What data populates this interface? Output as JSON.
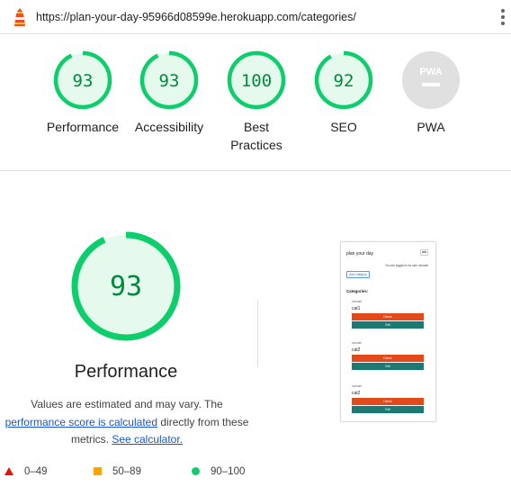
{
  "topbar": {
    "url": "https://plan-your-day-95966d08599e.herokuapp.com/categories/",
    "logo_icon": "lighthouse-icon",
    "menu_icon": "kebab-menu-icon"
  },
  "colors": {
    "pass": "#0cce6b",
    "pass_fill": "#e5f9ed",
    "pass_text": "#008a3e",
    "average": "#ffa400",
    "fail": "#eb0f00",
    "na": "#e0e0e0",
    "link": "#1a56c0",
    "delete_button": "#e2491b",
    "edit_button": "#1d7a72"
  },
  "gauges": [
    {
      "score": 93,
      "label": "Performance"
    },
    {
      "score": 93,
      "label": "Accessibility"
    },
    {
      "score": 100,
      "label": "Best Practices",
      "label_line1": "Best",
      "label_line2": "Practices"
    },
    {
      "score": 92,
      "label": "SEO"
    },
    {
      "score": null,
      "label": "PWA",
      "badge": "PWA"
    }
  ],
  "detail": {
    "score": 93,
    "title": "Performance",
    "desc_prefix": "Values are estimated and may vary. The",
    "desc_link": "performance score is calculated",
    "desc_middle": "directly from these metrics.",
    "calculator_link": "See calculator."
  },
  "legend": [
    {
      "range": "0–49",
      "shape": "triangle"
    },
    {
      "range": "50–89",
      "shape": "square"
    },
    {
      "range": "90–100",
      "shape": "circle"
    }
  ],
  "thumbnail": {
    "brand": "plan your day",
    "notice": "You are logged in as user michael",
    "add_button": "Add Category",
    "heading": "Categories:",
    "cards": [
      {
        "user": "michael",
        "name": "cat1",
        "delete": "Delete",
        "edit": "Edit"
      },
      {
        "user": "michael",
        "name": "cat2",
        "delete": "Delete",
        "edit": "Edit"
      },
      {
        "user": "michael",
        "name": "cat2",
        "delete": "Delete",
        "edit": "Edit"
      }
    ]
  }
}
